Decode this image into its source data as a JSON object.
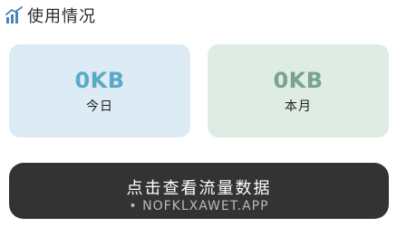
{
  "header": {
    "title": "使用情况",
    "icon": "bar-chart-icon",
    "icon_color": "#4b82b8"
  },
  "cards": {
    "today": {
      "value": "0KB",
      "label": "今日",
      "bg_color": "#dcebf4",
      "value_color": "#5ba8c9"
    },
    "month": {
      "value": "0KB",
      "label": "本月",
      "bg_color": "#deece4",
      "value_color": "#79a38e"
    }
  },
  "cta": {
    "label": "点击查看流量数据",
    "bg_color": "#333333"
  },
  "watermark": {
    "text": "• NOFKLXAWET.APP"
  }
}
